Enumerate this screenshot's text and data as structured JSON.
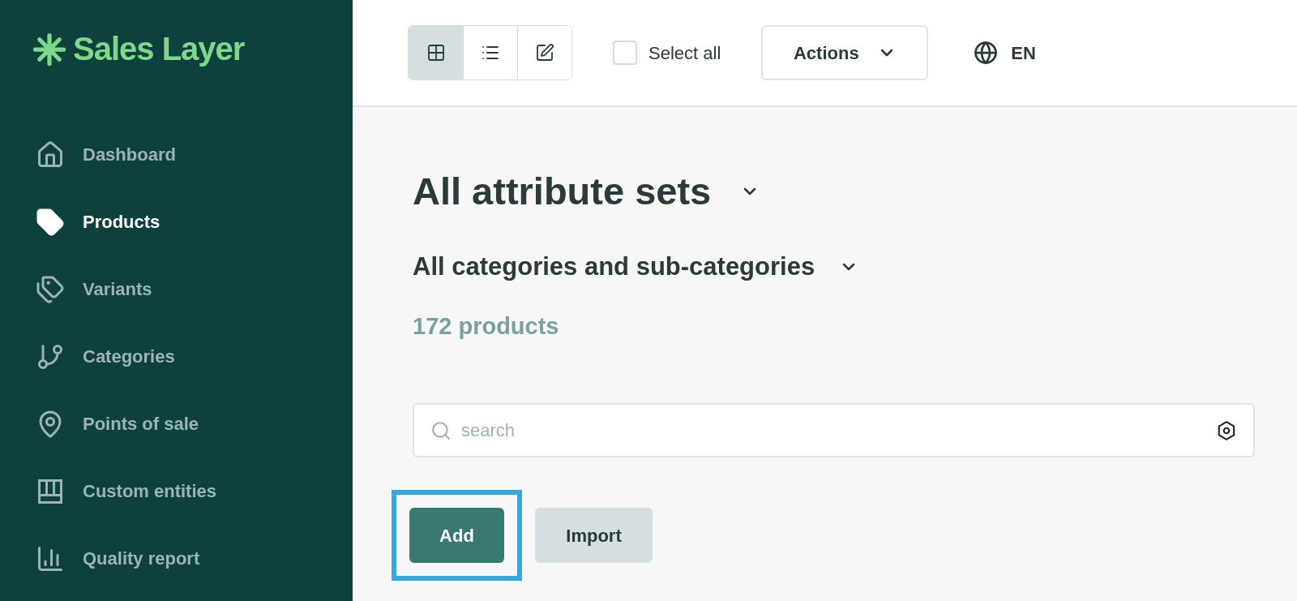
{
  "logo": {
    "text": "Sales Layer"
  },
  "sidebar": {
    "items": [
      {
        "label": "Dashboard",
        "selected": false
      },
      {
        "label": "Products",
        "selected": true
      },
      {
        "label": "Variants",
        "selected": false
      },
      {
        "label": "Categories",
        "selected": false
      },
      {
        "label": "Points of sale",
        "selected": false
      },
      {
        "label": "Custom entities",
        "selected": false
      },
      {
        "label": "Quality report",
        "selected": false
      }
    ]
  },
  "toolbar": {
    "views": [
      {
        "selected": true
      },
      {
        "selected": false
      },
      {
        "selected": false
      }
    ],
    "select_all": {
      "label": "Select all",
      "checked": false
    },
    "actions": {
      "label": "Actions"
    },
    "language": {
      "label": "EN"
    }
  },
  "main": {
    "title": "All attribute sets",
    "subtitle": "All categories and sub-categories",
    "count": "172 products",
    "search": {
      "placeholder": "search"
    },
    "buttons": [
      {
        "label": "Add",
        "kind": "primary",
        "highlighted": true
      },
      {
        "label": "Import",
        "kind": "secondary",
        "highlighted": false
      }
    ]
  }
}
